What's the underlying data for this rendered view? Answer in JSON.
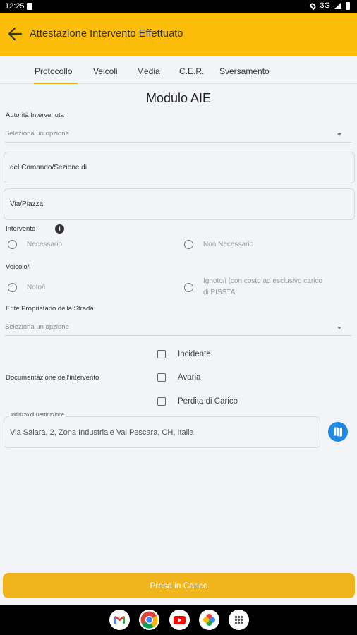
{
  "status_bar": {
    "time": "12:25",
    "network": "3G"
  },
  "app_bar": {
    "title": "Attestazione Intervento Effettuato"
  },
  "tabs": [
    {
      "label": "Protocollo",
      "active": true
    },
    {
      "label": "Veicoli"
    },
    {
      "label": "Media"
    },
    {
      "label": "C.E.R."
    },
    {
      "label": "Sversamento"
    }
  ],
  "form": {
    "title": "Modulo AIE",
    "autorita": {
      "label": "Autorità Intervenuta",
      "placeholder": "Seleziona un opzione"
    },
    "comando": {
      "value": "del Comando/Sezione di"
    },
    "via": {
      "value": "Via/Piazza"
    },
    "intervento": {
      "label": "Intervento",
      "options": [
        "Necessario",
        "Non Necessario"
      ]
    },
    "veicoli": {
      "label": "Veicolo/i",
      "options": [
        "Noto/i",
        "Ignoto/i (con costo ad esclusivo carico",
        "di PISSTA"
      ]
    },
    "ente": {
      "label": "Ente Proprietario della Strada",
      "placeholder": "Seleziona un opzione"
    },
    "documentazione": {
      "label": "Documentazione dell'intervento",
      "options": [
        "Incidente",
        "Avaria",
        "Perdita di Carico"
      ]
    },
    "destinazione": {
      "label": "Indirizzo di Destinazione",
      "value": "Via Salara, 2, Zona Industriale Val Pescara, CH, Italia"
    }
  },
  "actions": {
    "primary": "Presa in Carico"
  },
  "nav_apps": [
    "gmail-icon",
    "chrome-icon",
    "youtube-icon",
    "photos-icon",
    "app-drawer-icon"
  ],
  "colors": {
    "accent": "#fbbd0a",
    "button": "#f0b41c",
    "map_button": "#1e88e5",
    "background": "#f2f4f8"
  }
}
